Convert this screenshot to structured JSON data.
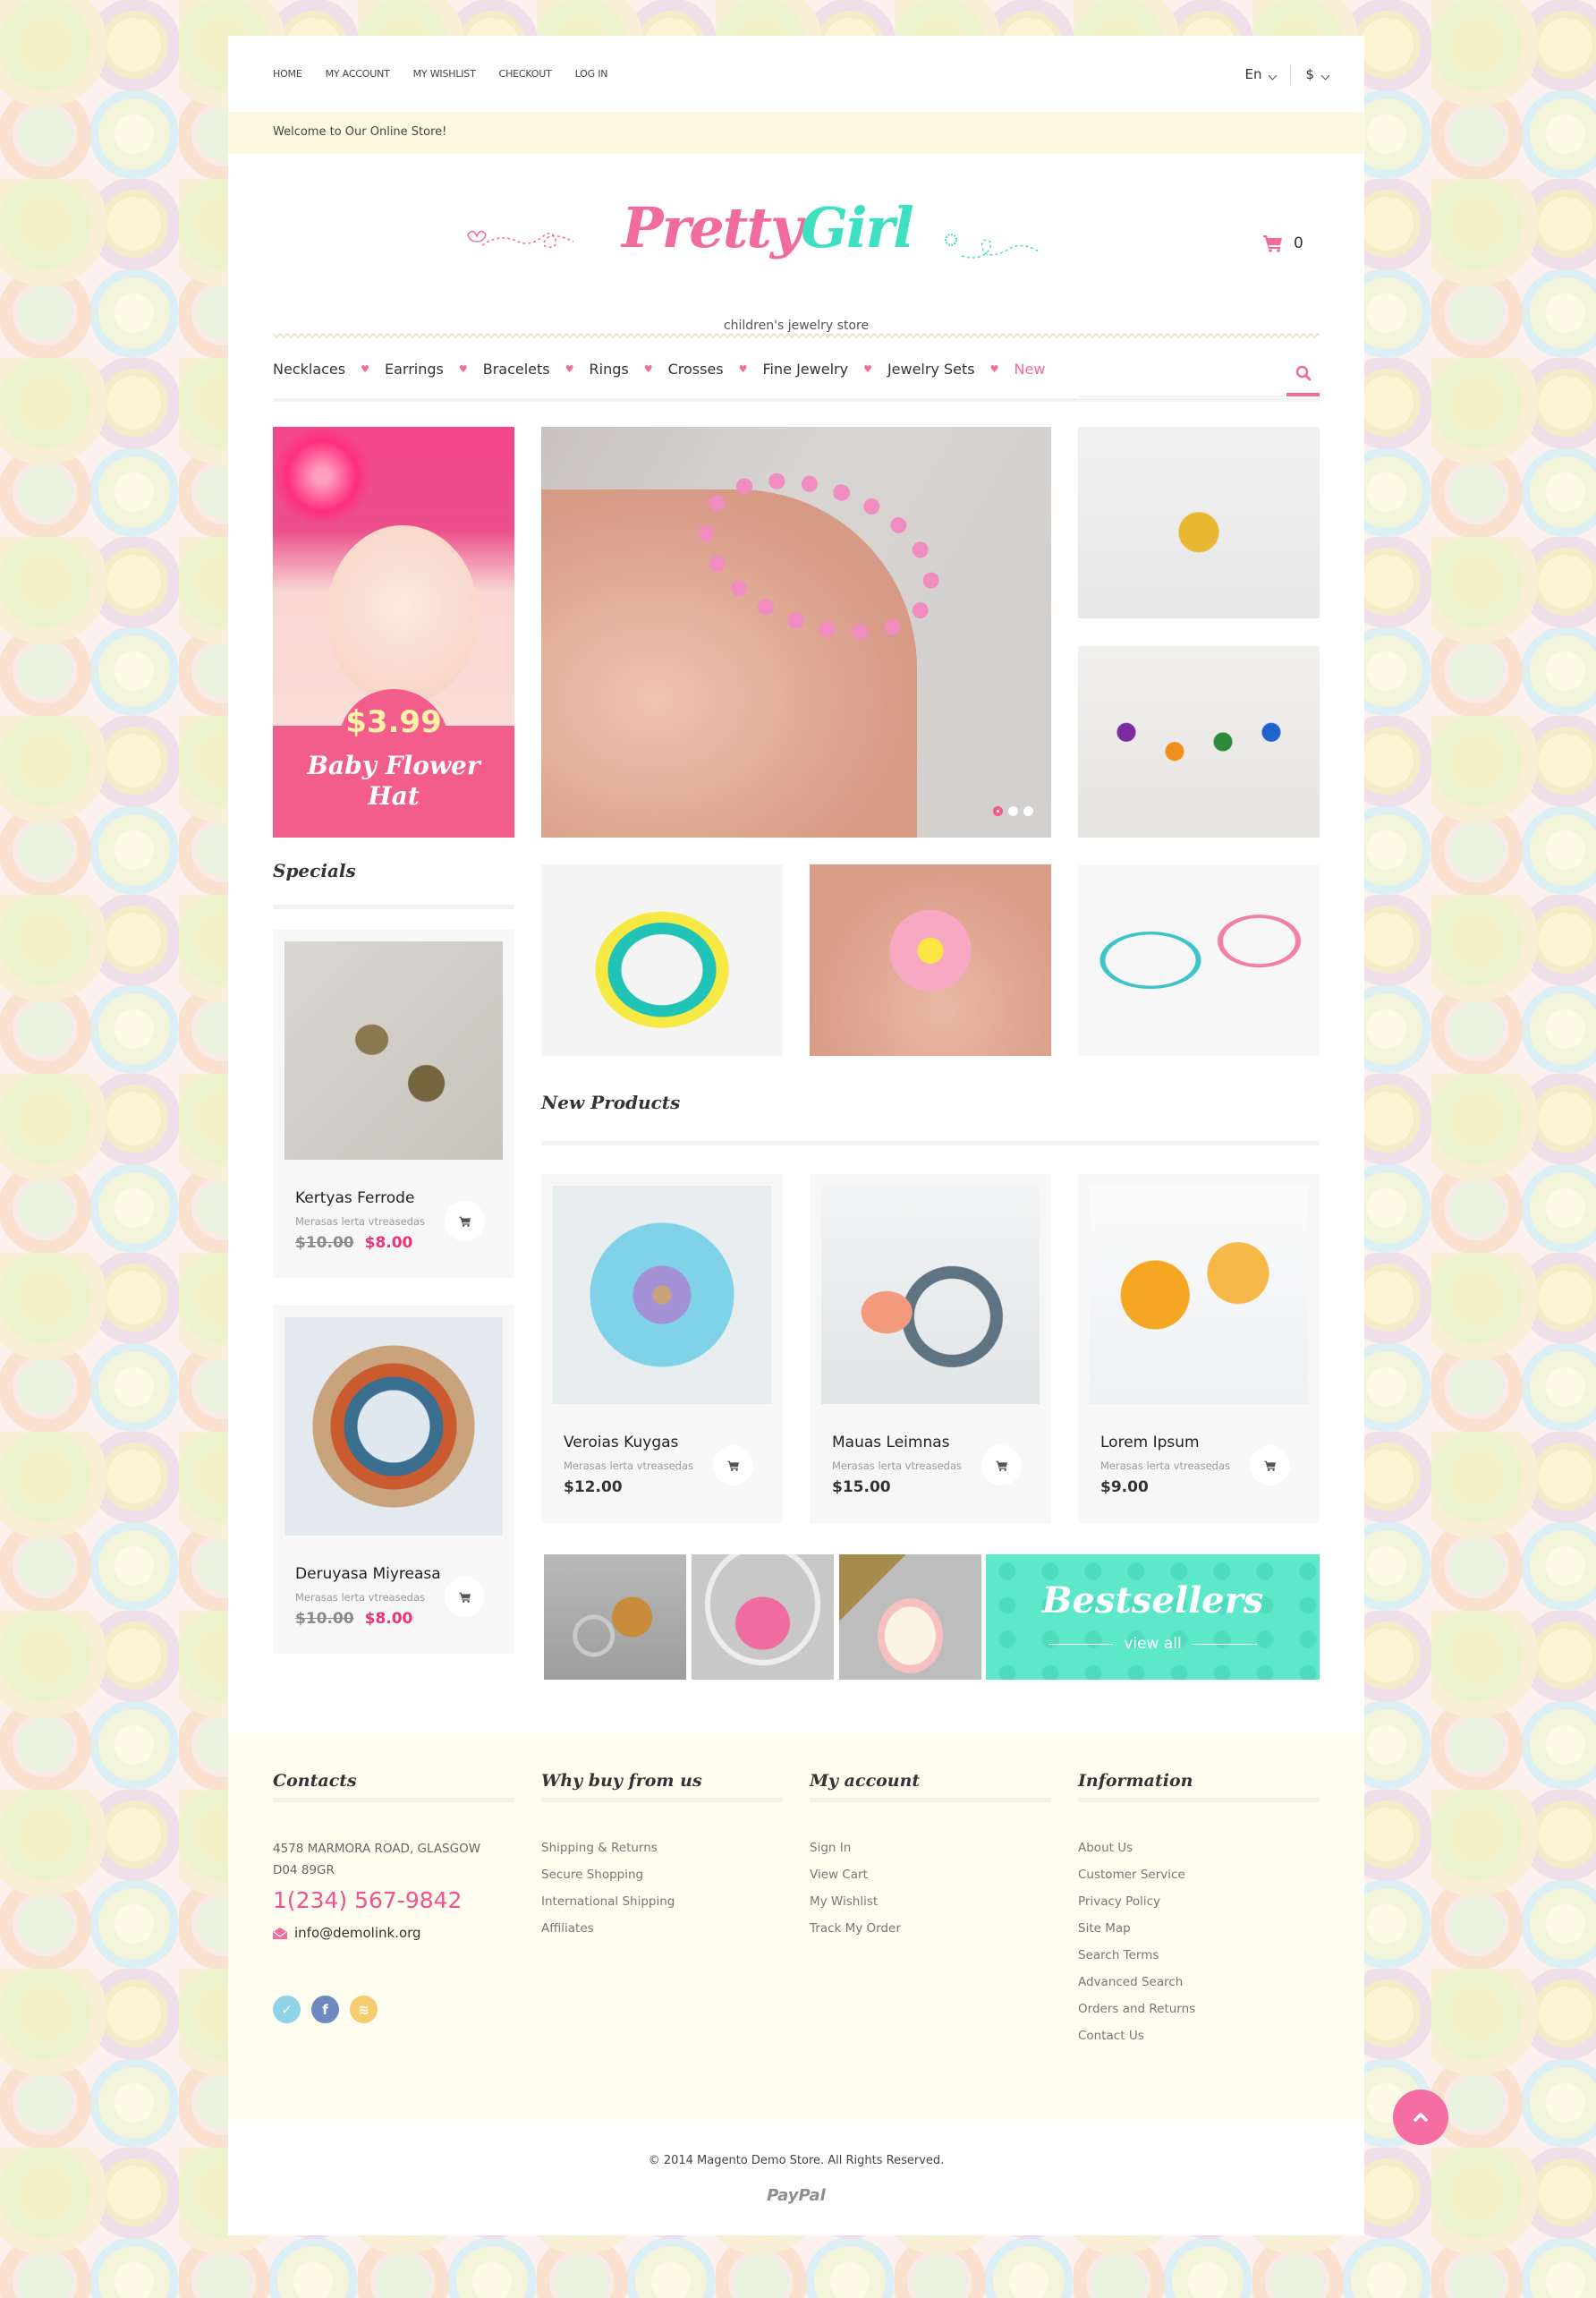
{
  "topbar": {
    "links": [
      "HOME",
      "MY ACCOUNT",
      "MY WISHLIST",
      "CHECKOUT",
      "LOG IN"
    ],
    "language": "En",
    "currency": "$",
    "welcome": "Welcome to Our Online Store!"
  },
  "logo": {
    "part1": "Pretty",
    "part2": "Girl",
    "tagline": "children's jewelry store"
  },
  "cart": {
    "icon": "cart-icon",
    "count": "0"
  },
  "nav": {
    "items": [
      "Necklaces",
      "Earrings",
      "Bracelets",
      "Rings",
      "Crosses",
      "Fine Jewelry",
      "Jewelry Sets",
      "New"
    ],
    "separator_icon": "heart-icon",
    "search_icon": "search-icon"
  },
  "promo": {
    "price": "$3.99",
    "title_line1": "Baby Flower",
    "title_line2": "Hat"
  },
  "slider": {
    "dots": 3,
    "active_dot": 1
  },
  "specials": {
    "heading": "Specials",
    "items": [
      {
        "name": "Kertyas Ferrode",
        "desc": "Merasas lerta vtreasedas",
        "old_price": "$10.00",
        "price": "$8.00"
      },
      {
        "name": "Deruyasa Miyreasa",
        "desc": "Merasas lerta vtreasedas",
        "old_price": "$10.00",
        "price": "$8.00"
      }
    ]
  },
  "new_products": {
    "heading": "New Products",
    "items": [
      {
        "name": "Veroias Kuygas",
        "desc": "Merasas lerta vtreasedas",
        "price": "$12.00"
      },
      {
        "name": "Mauas Leimnas",
        "desc": "Merasas lerta vtreasedas",
        "price": "$15.00"
      },
      {
        "name": "Lorem Ipsum",
        "desc": "Merasas lerta vtreasedas",
        "price": "$9.00"
      }
    ]
  },
  "bestsellers": {
    "title": "Bestsellers",
    "link": "view all"
  },
  "footer": {
    "contacts": {
      "heading": "Contacts",
      "address_line1": "4578 MARMORA ROAD, GLASGOW",
      "address_line2": "D04 89GR",
      "phone": "1(234) 567-9842",
      "email": "info@demolink.org",
      "social": [
        "twitter",
        "facebook",
        "rss"
      ]
    },
    "why": {
      "heading": "Why buy from us",
      "links": [
        "Shipping & Returns",
        "Secure Shopping",
        "International Shipping",
        "Affiliates"
      ]
    },
    "account": {
      "heading": "My account",
      "links": [
        "Sign In",
        "View Cart",
        "My Wishlist",
        "Track My Order"
      ]
    },
    "info": {
      "heading": "Information",
      "links": [
        "About Us",
        "Customer Service",
        "Privacy Policy",
        "Site Map",
        "Search Terms",
        "Advanced Search",
        "Orders and Returns",
        "Contact Us"
      ]
    },
    "copyright": "© 2014 Magento Demo Store. All Rights Reserved.",
    "payment": "PayPal"
  },
  "colors": {
    "pink": "#f25d8c",
    "teal": "#3fdfc1",
    "cream": "#fdf9e0"
  }
}
